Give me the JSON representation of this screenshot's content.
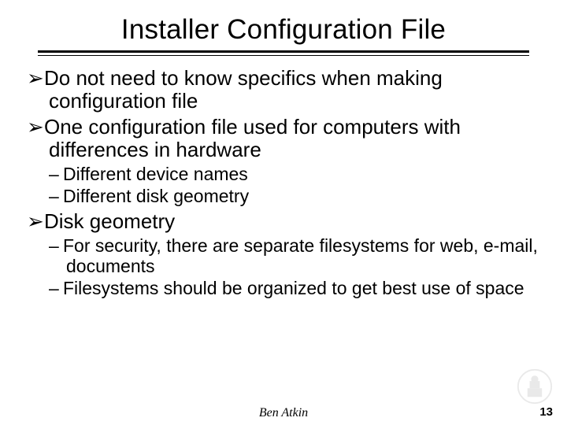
{
  "title": "Installer Configuration File",
  "bullets": {
    "b1": "Do not need to know specifics when making configuration file",
    "b2": "One configuration file used for computers with differences in hardware",
    "b2_sub1": "Different device names",
    "b2_sub2": "Different disk geometry",
    "b3": "Disk geometry",
    "b3_sub1": "For security, there are separate filesystems for web, e-mail, documents",
    "b3_sub2": "Filesystems should be organized to get best use of space"
  },
  "footer": {
    "author": "Ben Atkin",
    "page": "13"
  }
}
